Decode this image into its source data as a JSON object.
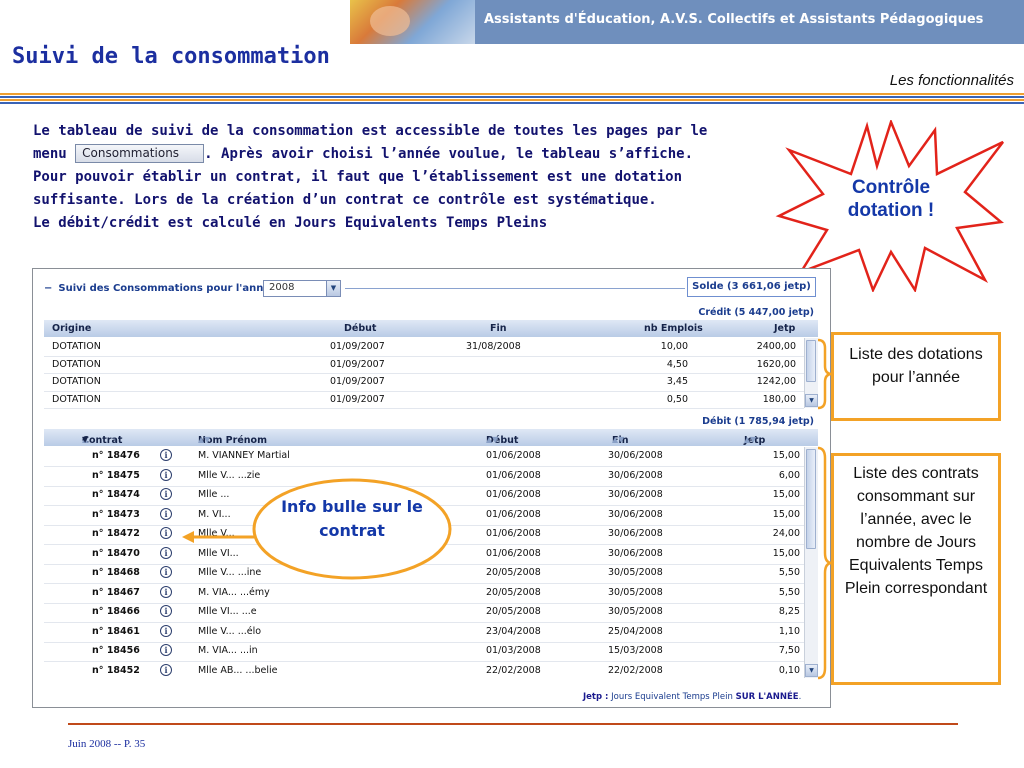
{
  "banner": {
    "title": "Assistants d'Éducation, A.V.S. Collectifs et Assistants Pédagogiques"
  },
  "page": {
    "title": "Suivi de la consommation",
    "subtitle": "Les fonctionnalités"
  },
  "description": {
    "line1": "Le tableau de suivi de la consommation est accessible de toutes les pages par le",
    "line2_prefix": "menu ",
    "menu_button": "Consommations",
    "line2_suffix": ". Après avoir choisi l’année voulue, le tableau s’affiche.",
    "line3": "Pour pouvoir établir un contrat, il faut que l’établissement est une dotation",
    "line4": "suffisante. Lors de la création d’un contrat ce contrôle est systématique.",
    "line5": "Le débit/crédit est calculé en Jours Equivalents Temps Pleins"
  },
  "callout": {
    "line1": "Contrôle",
    "line2": "dotation !"
  },
  "app": {
    "section_title": "Suivi des Consommations pour l'année",
    "collapse_symbol": "−",
    "year_value": "2008",
    "solde_label": "Solde (3 661,06 jetp)",
    "credit_label": "Crédit (5 447,00 jetp)",
    "debit_label": "Débit (1 785,94 jetp)",
    "dotations": {
      "headers": [
        "Origine",
        "Début",
        "Fin",
        "nb Emplois",
        "Jetp"
      ],
      "rows": [
        [
          "DOTATION",
          "01/09/2007",
          "31/08/2008",
          "10,00",
          "2400,00"
        ],
        [
          "DOTATION",
          "01/09/2007",
          "",
          "4,50",
          "1620,00"
        ],
        [
          "DOTATION",
          "01/09/2007",
          "",
          "3,45",
          "1242,00"
        ],
        [
          "DOTATION",
          "01/09/2007",
          "",
          "0,50",
          "180,00"
        ]
      ]
    },
    "contrats": {
      "headers": [
        "Contrat",
        "Nom Prénom",
        "Début",
        "Fin",
        "Jetp"
      ],
      "rows": [
        [
          "n° 18476",
          "M. VIANNEY Martial",
          "01/06/2008",
          "30/06/2008",
          "15,00"
        ],
        [
          "n° 18475",
          "Mlle V... ...zie",
          "01/06/2008",
          "30/06/2008",
          "6,00"
        ],
        [
          "n° 18474",
          "Mlle ...",
          "01/06/2008",
          "30/06/2008",
          "15,00"
        ],
        [
          "n° 18473",
          "M. VI...",
          "01/06/2008",
          "30/06/2008",
          "15,00"
        ],
        [
          "n° 18472",
          "Mlle V...",
          "01/06/2008",
          "30/06/2008",
          "24,00"
        ],
        [
          "n° 18470",
          "Mlle VI...",
          "01/06/2008",
          "30/06/2008",
          "15,00"
        ],
        [
          "n° 18468",
          "Mlle V... ...ine",
          "20/05/2008",
          "30/05/2008",
          "5,50"
        ],
        [
          "n° 18467",
          "M. VIA... ...émy",
          "20/05/2008",
          "30/05/2008",
          "5,50"
        ],
        [
          "n° 18466",
          "Mlle VI... ...e",
          "20/05/2008",
          "30/05/2008",
          "8,25"
        ],
        [
          "n° 18461",
          "Mlle V... ...élo",
          "23/04/2008",
          "25/04/2008",
          "1,10"
        ],
        [
          "n° 18456",
          "M. VIA... ...in",
          "01/03/2008",
          "15/03/2008",
          "7,50"
        ],
        [
          "n° 18452",
          "Mlle AB... ...belie",
          "22/02/2008",
          "22/02/2008",
          "0,10"
        ]
      ]
    },
    "footer_key": "Jetp :",
    "footer_text": "Jours Equivalent Temps Plein",
    "footer_emph": "SUR L'ANNÉE",
    "footer_end": "."
  },
  "annotations": {
    "info_bulle": "Info bulle sur le contrat",
    "dotations_box": "Liste des dotations pour l’année",
    "contrats_box": "Liste des contrats consommant sur l’année, avec le nombre de Jours Equivalents Temps Plein correspondant"
  },
  "footer": {
    "text": "Juin 2008 -- P. 35"
  }
}
